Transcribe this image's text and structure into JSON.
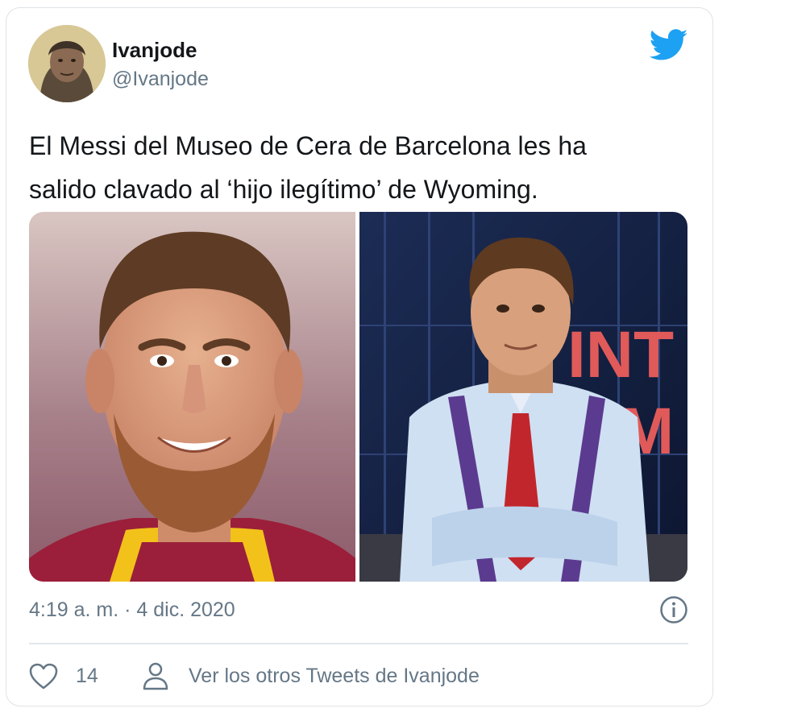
{
  "tweet": {
    "author": {
      "display_name": "Ivanjode",
      "handle": "@Ivanjode",
      "avatar_icon": "avatar-portrait"
    },
    "text_line1": "El Messi del Museo de Cera de Barcelona les ha",
    "text_line2": "salido clavado al ‘hijo ilegítimo’ de Wyoming.",
    "media": [
      {
        "name": "wax-figure-photo"
      },
      {
        "name": "presenter-photo",
        "background_text": "INT M"
      }
    ],
    "timestamp": "4:19 a. m. · 4 dic. 2020",
    "likes": "14",
    "profile_link": "Ver los otros Tweets de Ivanjode"
  },
  "icons": {
    "brand": "twitter-bird-icon",
    "info": "info-icon",
    "like": "heart-icon",
    "profile": "person-icon"
  },
  "colors": {
    "brand_blue": "#1da1f2",
    "text_primary": "#14171a",
    "text_secondary": "#657786",
    "border": "#dfe3e6"
  }
}
